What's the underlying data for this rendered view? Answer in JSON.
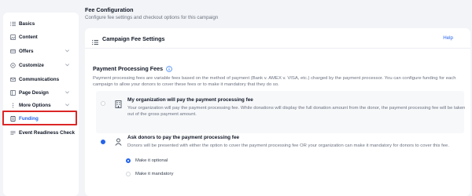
{
  "sidebar": {
    "items": [
      {
        "label": "Basics",
        "icon": "list-icon",
        "has_chevron": false
      },
      {
        "label": "Content",
        "icon": "image-icon",
        "has_chevron": false
      },
      {
        "label": "Offers",
        "icon": "tag-icon",
        "has_chevron": true
      },
      {
        "label": "Customize",
        "icon": "brush-icon",
        "has_chevron": true
      },
      {
        "label": "Communications",
        "icon": "mail-icon",
        "has_chevron": false
      },
      {
        "label": "Page Design",
        "icon": "layout-icon",
        "has_chevron": true
      },
      {
        "label": "More Options",
        "icon": "dots-icon",
        "has_chevron": true
      },
      {
        "label": "Funding",
        "icon": "document-icon",
        "has_chevron": false,
        "active": true
      },
      {
        "label": "Event Readiness Check",
        "icon": "checklist-icon",
        "has_chevron": false
      }
    ]
  },
  "header": {
    "title": "Fee Configuration",
    "subtitle": "Configure fee settings and checkout options for this campaign"
  },
  "card": {
    "title": "Campaign Fee Settings",
    "help_label": "Help"
  },
  "section": {
    "title": "Payment Processing Fees",
    "description": "Payment processing fees are variable fees based on the method of payment (Bank v. AMEX v. VISA, etc.) charged by the payment processor. You can configure funding for each campaign to allow your donors to cover these fees or to make it mandatory that they do so."
  },
  "options": [
    {
      "title": "My organization will pay the payment processing fee",
      "description": "Your organization will pay the payment processing fee. While donations will display the full donation amount from the donor, the payment processing fee will be taken out of the gross payment amount.",
      "selected": false
    },
    {
      "title": "Ask donors to pay the payment processing fee",
      "description": "Donors will be presented with either the option to cover the payment processing fee OR your organization can make it mandatory for donors to cover this fee.",
      "selected": true,
      "sub_options": [
        {
          "label": "Make it optional",
          "selected": true
        },
        {
          "label": "Make it mandatory",
          "selected": false
        }
      ]
    }
  ],
  "colors": {
    "accent": "#2563eb",
    "highlight_border": "#dc2626",
    "background": "#f3f4f7"
  }
}
